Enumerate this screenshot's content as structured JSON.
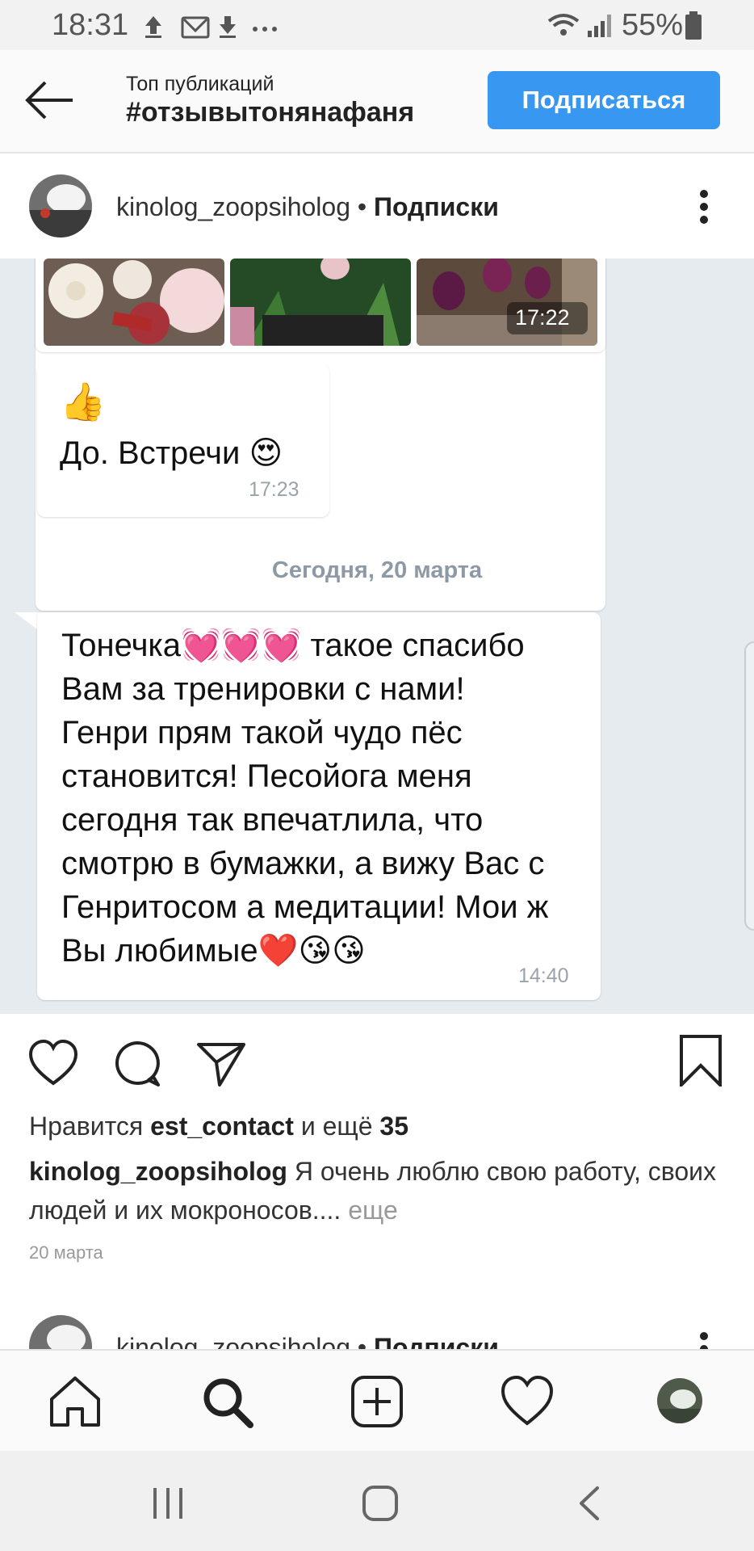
{
  "status_bar": {
    "time": "18:31",
    "icons": [
      "upload-icon",
      "mail-icon",
      "download-icon",
      "more-dots"
    ],
    "battery": "55%"
  },
  "header": {
    "subtitle": "Топ публикаций",
    "hashtag": "#отзывытонянафаня",
    "subscribe_label": "Подписаться"
  },
  "post": {
    "username": "kinolog_zoopsiholog",
    "separator": " • ",
    "follow_state": "Подписки",
    "chat": {
      "photos_time": "17:22",
      "reply_emoji": "👍",
      "reply_text": "До. Встречи 😍",
      "reply_time": "17:23",
      "date_separator": "Сегодня, 20 марта",
      "message_lines": [
        "Тонечка💓💓💓 такое спасибо",
        "Вам за тренировки с нами!",
        "Генри прям такой чудо пёс",
        "становится! Песойога меня",
        "сегодня так впечатлила, что",
        "смотрю в бумажки, а вижу Вас с",
        "Генритосом а медитации! Мои ж",
        "Вы любимые❤️😘😘"
      ],
      "message_time": "14:40"
    },
    "likes_prefix": "Нравится ",
    "likes_user": "est_contact",
    "likes_middle": " и ещё ",
    "likes_count": "35",
    "caption_user": "kinolog_zoopsiholog",
    "caption_text": " Я очень люблю свою работу, своих людей и их мокроносов....",
    "caption_more": " еще",
    "date": "20 марта"
  },
  "next_post": {
    "username": "kinolog_zoopsiholog",
    "separator": " • ",
    "follow_state": "Подписки"
  },
  "colors": {
    "accent": "#3897f0",
    "chat_bg": "#e6ebf0",
    "date_sep": "#8e99a6"
  }
}
